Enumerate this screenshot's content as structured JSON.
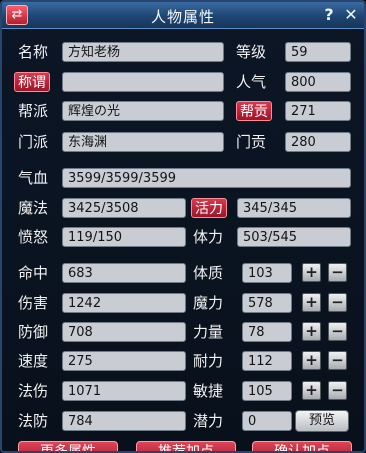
{
  "window": {
    "title": "人物属性",
    "swap_icon": "⇄",
    "help_label": "?",
    "close_label": "✕"
  },
  "basic": {
    "name_label": "名称",
    "name_value": "方知老杨",
    "level_label": "等级",
    "level_value": "59",
    "title_label": "称谓",
    "title_value": "",
    "popularity_label": "人气",
    "popularity_value": "800",
    "guild_label": "帮派",
    "guild_value": "辉煌の光",
    "guild_contrib_label": "帮贡",
    "guild_contrib_value": "271",
    "school_label": "门派",
    "school_value": "东海渊",
    "school_contrib_label": "门贡",
    "school_contrib_value": "280"
  },
  "vitals": {
    "hp_label": "气血",
    "hp_value": "3599/3599/3599",
    "mp_label": "魔法",
    "mp_value": "3425/3508",
    "vigor_label": "活力",
    "vigor_value": "345/345",
    "rage_label": "愤怒",
    "rage_value": "119/150",
    "stamina_label": "体力",
    "stamina_value": "503/545"
  },
  "combat": [
    {
      "label": "命中",
      "value": "683"
    },
    {
      "label": "伤害",
      "value": "1242"
    },
    {
      "label": "防御",
      "value": "708"
    },
    {
      "label": "速度",
      "value": "275"
    },
    {
      "label": "法伤",
      "value": "1071"
    },
    {
      "label": "法防",
      "value": "784"
    }
  ],
  "attributes": [
    {
      "label": "体质",
      "value": "103"
    },
    {
      "label": "魔力",
      "value": "578"
    },
    {
      "label": "力量",
      "value": "78"
    },
    {
      "label": "耐力",
      "value": "112"
    },
    {
      "label": "敏捷",
      "value": "105"
    }
  ],
  "potential": {
    "label": "潜力",
    "value": "0",
    "preview_label": "预览"
  },
  "controls": {
    "plus": "+",
    "minus": "−"
  },
  "bottom_buttons": {
    "more_attributes": "更多属性",
    "recommend": "推荐加点",
    "confirm": "确认加点"
  }
}
